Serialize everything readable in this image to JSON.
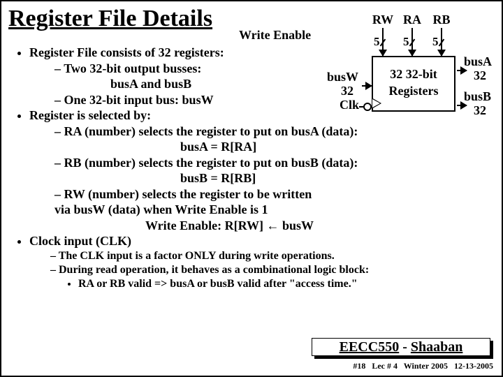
{
  "title": "Register File Details",
  "writeEnable": "Write Enable",
  "bullets": {
    "b1": "Register File consists of 32 registers:",
    "b1a": "Two 32-bit output busses:",
    "b1a_sub": "busA  and  busB",
    "b1b": "One 32-bit input bus: busW",
    "b2": "Register is selected by:",
    "b2a": "RA (number) selects the register to put on busA (data):",
    "b2a_eq": "busA = R[RA]",
    "b2b": "RB (number) selects the register to put on busB (data):",
    "b2b_eq": "busB = R[RB]",
    "b2c": "RW (number) selects the register to be  written",
    "b2c_via": "via busW (data) when Write Enable is 1",
    "b2c_eq": "Write Enable:    R[RW] ←   busW",
    "b3": "Clock input (CLK)",
    "b3a": "The CLK input is a factor ONLY during write operations.",
    "b3b": "During read operation, it behaves as a combinational logic block:",
    "b3b1": "RA or RB valid  =>  busA or  busB valid after \"access time.\""
  },
  "diagram": {
    "rw": "RW",
    "ra": "RA",
    "rb": "RB",
    "five": "5",
    "box1": "32 32-bit",
    "box2": "Registers",
    "busW": "busW",
    "n32": "32",
    "clk": "Clk",
    "busA": "busA",
    "busB": "busB"
  },
  "course": {
    "code": "EECC550",
    "dash": " - ",
    "name": "Shaaban"
  },
  "footer": {
    "slide": "#18",
    "lec": "Lec # 4",
    "term": "Winter 2005",
    "date": "12-13-2005"
  }
}
